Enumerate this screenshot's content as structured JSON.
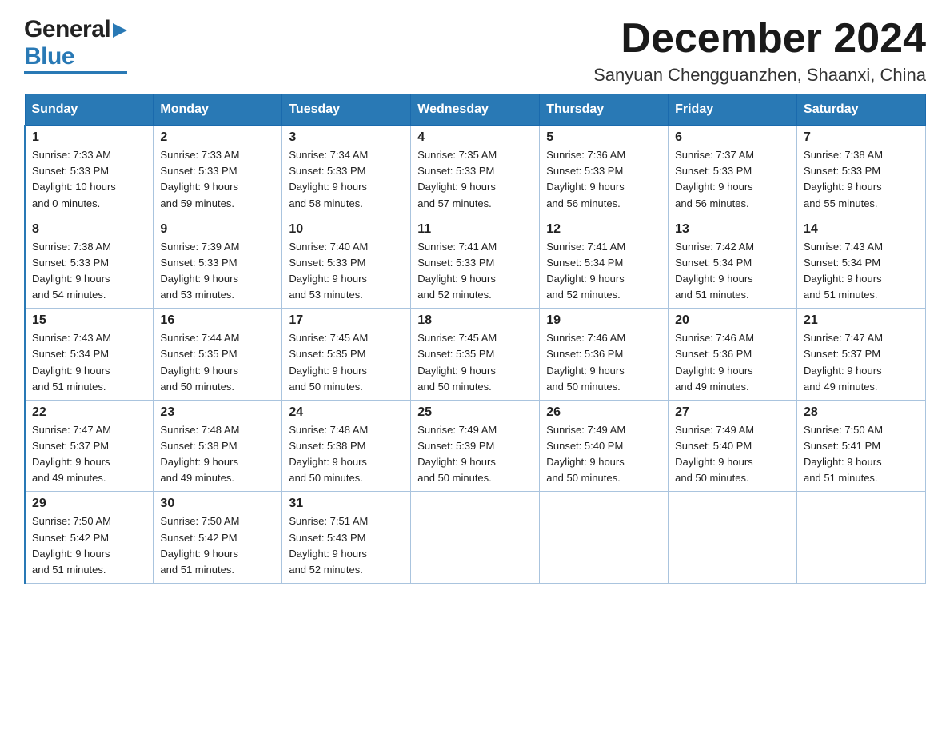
{
  "header": {
    "logo_general": "General",
    "logo_blue": "Blue",
    "month_title": "December 2024",
    "location": "Sanyuan Chengguanzhen, Shaanxi, China"
  },
  "days_of_week": [
    "Sunday",
    "Monday",
    "Tuesday",
    "Wednesday",
    "Thursday",
    "Friday",
    "Saturday"
  ],
  "weeks": [
    [
      {
        "day": "1",
        "info": "Sunrise: 7:33 AM\nSunset: 5:33 PM\nDaylight: 10 hours\nand 0 minutes."
      },
      {
        "day": "2",
        "info": "Sunrise: 7:33 AM\nSunset: 5:33 PM\nDaylight: 9 hours\nand 59 minutes."
      },
      {
        "day": "3",
        "info": "Sunrise: 7:34 AM\nSunset: 5:33 PM\nDaylight: 9 hours\nand 58 minutes."
      },
      {
        "day": "4",
        "info": "Sunrise: 7:35 AM\nSunset: 5:33 PM\nDaylight: 9 hours\nand 57 minutes."
      },
      {
        "day": "5",
        "info": "Sunrise: 7:36 AM\nSunset: 5:33 PM\nDaylight: 9 hours\nand 56 minutes."
      },
      {
        "day": "6",
        "info": "Sunrise: 7:37 AM\nSunset: 5:33 PM\nDaylight: 9 hours\nand 56 minutes."
      },
      {
        "day": "7",
        "info": "Sunrise: 7:38 AM\nSunset: 5:33 PM\nDaylight: 9 hours\nand 55 minutes."
      }
    ],
    [
      {
        "day": "8",
        "info": "Sunrise: 7:38 AM\nSunset: 5:33 PM\nDaylight: 9 hours\nand 54 minutes."
      },
      {
        "day": "9",
        "info": "Sunrise: 7:39 AM\nSunset: 5:33 PM\nDaylight: 9 hours\nand 53 minutes."
      },
      {
        "day": "10",
        "info": "Sunrise: 7:40 AM\nSunset: 5:33 PM\nDaylight: 9 hours\nand 53 minutes."
      },
      {
        "day": "11",
        "info": "Sunrise: 7:41 AM\nSunset: 5:33 PM\nDaylight: 9 hours\nand 52 minutes."
      },
      {
        "day": "12",
        "info": "Sunrise: 7:41 AM\nSunset: 5:34 PM\nDaylight: 9 hours\nand 52 minutes."
      },
      {
        "day": "13",
        "info": "Sunrise: 7:42 AM\nSunset: 5:34 PM\nDaylight: 9 hours\nand 51 minutes."
      },
      {
        "day": "14",
        "info": "Sunrise: 7:43 AM\nSunset: 5:34 PM\nDaylight: 9 hours\nand 51 minutes."
      }
    ],
    [
      {
        "day": "15",
        "info": "Sunrise: 7:43 AM\nSunset: 5:34 PM\nDaylight: 9 hours\nand 51 minutes."
      },
      {
        "day": "16",
        "info": "Sunrise: 7:44 AM\nSunset: 5:35 PM\nDaylight: 9 hours\nand 50 minutes."
      },
      {
        "day": "17",
        "info": "Sunrise: 7:45 AM\nSunset: 5:35 PM\nDaylight: 9 hours\nand 50 minutes."
      },
      {
        "day": "18",
        "info": "Sunrise: 7:45 AM\nSunset: 5:35 PM\nDaylight: 9 hours\nand 50 minutes."
      },
      {
        "day": "19",
        "info": "Sunrise: 7:46 AM\nSunset: 5:36 PM\nDaylight: 9 hours\nand 50 minutes."
      },
      {
        "day": "20",
        "info": "Sunrise: 7:46 AM\nSunset: 5:36 PM\nDaylight: 9 hours\nand 49 minutes."
      },
      {
        "day": "21",
        "info": "Sunrise: 7:47 AM\nSunset: 5:37 PM\nDaylight: 9 hours\nand 49 minutes."
      }
    ],
    [
      {
        "day": "22",
        "info": "Sunrise: 7:47 AM\nSunset: 5:37 PM\nDaylight: 9 hours\nand 49 minutes."
      },
      {
        "day": "23",
        "info": "Sunrise: 7:48 AM\nSunset: 5:38 PM\nDaylight: 9 hours\nand 49 minutes."
      },
      {
        "day": "24",
        "info": "Sunrise: 7:48 AM\nSunset: 5:38 PM\nDaylight: 9 hours\nand 50 minutes."
      },
      {
        "day": "25",
        "info": "Sunrise: 7:49 AM\nSunset: 5:39 PM\nDaylight: 9 hours\nand 50 minutes."
      },
      {
        "day": "26",
        "info": "Sunrise: 7:49 AM\nSunset: 5:40 PM\nDaylight: 9 hours\nand 50 minutes."
      },
      {
        "day": "27",
        "info": "Sunrise: 7:49 AM\nSunset: 5:40 PM\nDaylight: 9 hours\nand 50 minutes."
      },
      {
        "day": "28",
        "info": "Sunrise: 7:50 AM\nSunset: 5:41 PM\nDaylight: 9 hours\nand 51 minutes."
      }
    ],
    [
      {
        "day": "29",
        "info": "Sunrise: 7:50 AM\nSunset: 5:42 PM\nDaylight: 9 hours\nand 51 minutes."
      },
      {
        "day": "30",
        "info": "Sunrise: 7:50 AM\nSunset: 5:42 PM\nDaylight: 9 hours\nand 51 minutes."
      },
      {
        "day": "31",
        "info": "Sunrise: 7:51 AM\nSunset: 5:43 PM\nDaylight: 9 hours\nand 52 minutes."
      },
      {
        "day": "",
        "info": ""
      },
      {
        "day": "",
        "info": ""
      },
      {
        "day": "",
        "info": ""
      },
      {
        "day": "",
        "info": ""
      }
    ]
  ]
}
